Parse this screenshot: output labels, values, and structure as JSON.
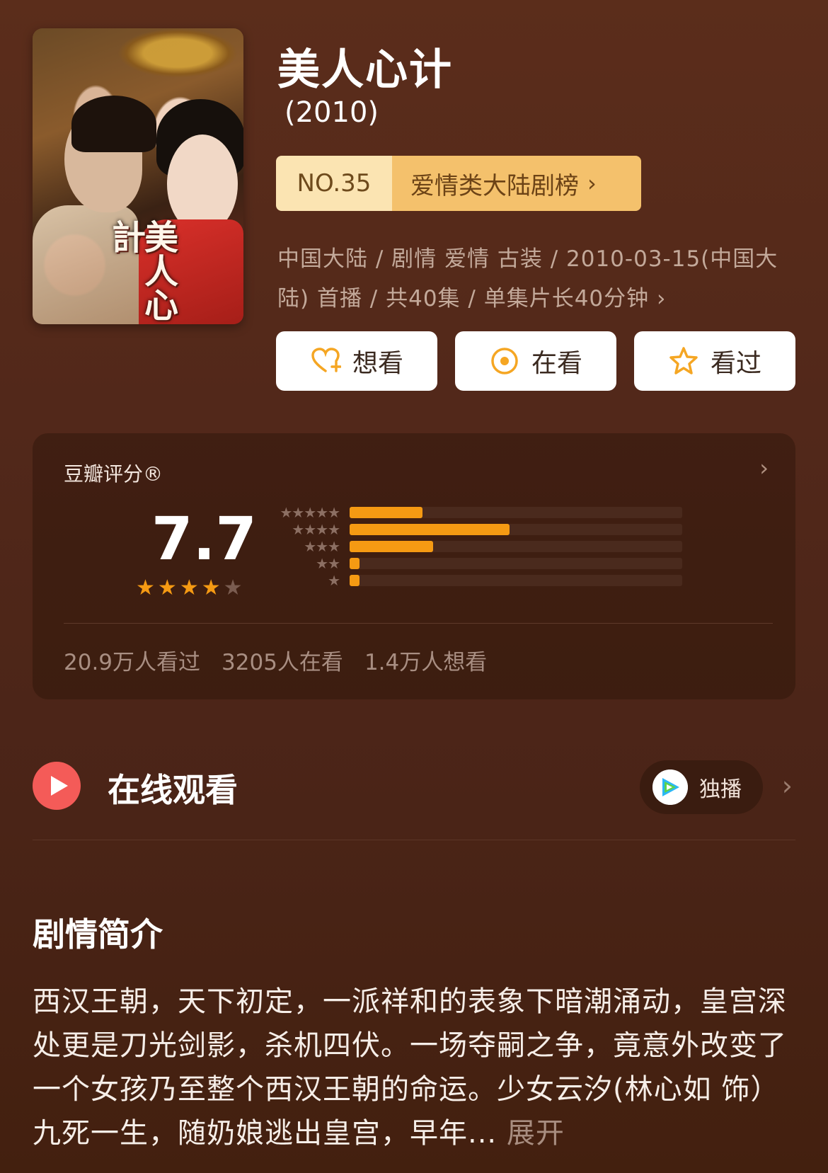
{
  "show": {
    "title": "美人心计",
    "year": "(2010)",
    "poster_text": "美人心計"
  },
  "rank": {
    "number": "NO.35",
    "list_name": "爱情类大陆剧榜",
    "chevron": "›"
  },
  "meta": {
    "line": "中国大陆 / 剧情 爱情 古装 / 2010-03-15(中国大陆) 首播 / 共40集 / 单集片长40分钟",
    "chevron": "›"
  },
  "actions": [
    {
      "label": "想看",
      "icon": "heart-plus-icon"
    },
    {
      "label": "在看",
      "icon": "target-icon"
    },
    {
      "label": "看过",
      "icon": "star-outline-icon"
    }
  ],
  "rating": {
    "label": "豆瓣评分®",
    "score": "7.7",
    "stars_filled": 4,
    "stars_total": 5,
    "distribution": [
      {
        "stars": "★★★★★",
        "fraction": 0.22
      },
      {
        "stars": "★★★★",
        "fraction": 0.48
      },
      {
        "stars": "★★★",
        "fraction": 0.25
      },
      {
        "stars": "★★",
        "fraction": 0.03
      },
      {
        "stars": "★",
        "fraction": 0.03
      }
    ],
    "counts": [
      "20.9万人看过",
      "3205人在看",
      "1.4万人想看"
    ],
    "chevron": "›"
  },
  "watch": {
    "title": "在线观看",
    "platform_label": "独播",
    "platform_icon": "tencent-video-icon",
    "chevron": "›"
  },
  "synopsis": {
    "title": "剧情简介",
    "text": "西汉王朝，天下初定，一派祥和的表象下暗潮涌动，皇宫深处更是刀光剑影，杀机四伏。一场夺嗣之争，竟意外改变了一个女孩乃至整个西汉王朝的命运。少女云汐(林心如 饰）九死一生，随奶娘逃出皇宫，早年...",
    "more": " 展开"
  },
  "colors": {
    "accent_orange": "#f59a13",
    "rank_light": "#fbe4b2",
    "rank_dark": "#f4c16c",
    "play_red": "#f45b58",
    "background": "#52281a"
  }
}
